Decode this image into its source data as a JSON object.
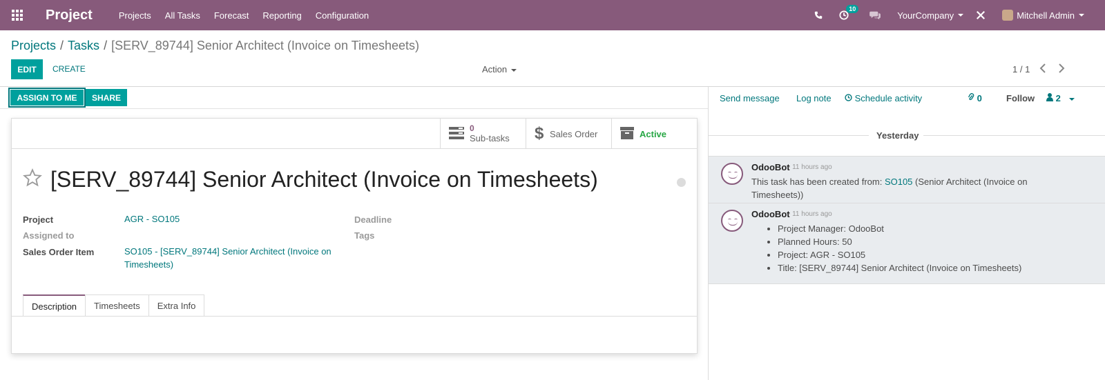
{
  "navbar": {
    "brand": "Project",
    "menu": [
      "Projects",
      "All Tasks",
      "Forecast",
      "Reporting",
      "Configuration"
    ],
    "activity_count": "10",
    "company": "YourCompany",
    "user": "Mitchell Admin"
  },
  "breadcrumb": {
    "projects": "Projects",
    "tasks": "Tasks",
    "current": "[SERV_89744] Senior Architect (Invoice on Timesheets)",
    "sep": "/"
  },
  "control": {
    "edit": "EDIT",
    "create": "CREATE",
    "action": "Action",
    "pager": "1 / 1"
  },
  "statusbar": {
    "assign": "ASSIGN TO ME",
    "share": "SHARE"
  },
  "smart_buttons": {
    "subtasks_count": "0",
    "subtasks_label": "Sub-tasks",
    "sales_order": "Sales Order",
    "active": "Active"
  },
  "task": {
    "title": "[SERV_89744] Senior Architect (Invoice on Timesheets)",
    "project_label": "Project",
    "project_value": "AGR - SO105",
    "assigned_label": "Assigned to",
    "sale_item_label": "Sales Order Item",
    "sale_item_value_1": "SO105 - [SERV_89744] Senior Architect (Invoice on",
    "sale_item_value_2": "Timesheets)",
    "deadline_label": "Deadline",
    "tags_label": "Tags"
  },
  "tabs": [
    "Description",
    "Timesheets",
    "Extra Info"
  ],
  "chatter": {
    "send_message": "Send message",
    "log_note": "Log note",
    "schedule": "Schedule activity",
    "attachments": "0",
    "follow": "Follow",
    "followers": "2",
    "day": "Yesterday",
    "messages": [
      {
        "author": "OdooBot",
        "date": "- 11 hours ago",
        "text_before": "This task has been created from: ",
        "link": "SO105",
        "text_after": " (Senior Architect (Invoice on Timesheets))"
      },
      {
        "author": "OdooBot",
        "date": "- 11 hours ago",
        "items": [
          "Project Manager: OdooBot",
          "Planned Hours: 50",
          "Project: AGR - SO105",
          "Title: [SERV_89744] Senior Architect (Invoice on Timesheets)"
        ]
      }
    ]
  },
  "colors": {
    "brand": "#875a7b",
    "primary": "#00a09d",
    "link": "#00777c",
    "active": "#28a745"
  }
}
